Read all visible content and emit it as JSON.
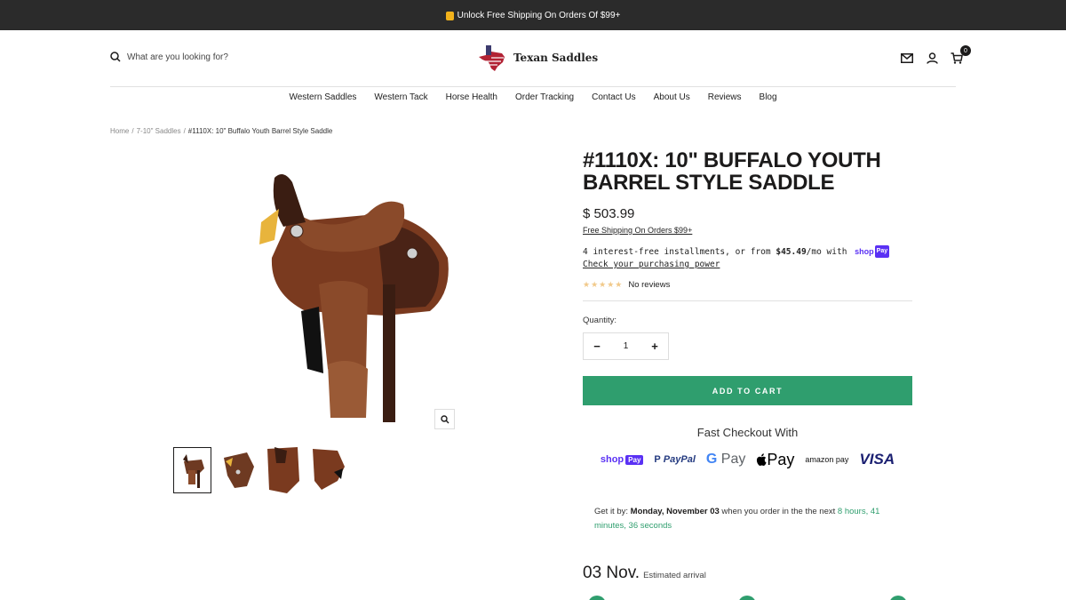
{
  "announcement": {
    "text": "Unlock Free Shipping On Orders Of $99+"
  },
  "header": {
    "search_placeholder": "What are you looking for?",
    "logo_text": "Texan Saddles",
    "cart_count": "0"
  },
  "nav": {
    "items": [
      "Western Saddles",
      "Western Tack",
      "Horse Health",
      "Order Tracking",
      "Contact Us",
      "About Us",
      "Reviews",
      "Blog"
    ]
  },
  "breadcrumb": {
    "home": "Home",
    "category": "7-10\" Saddles",
    "current": "#1110X: 10\" Buffalo Youth Barrel Style Saddle",
    "separator": "/"
  },
  "product": {
    "title": "#1110X: 10\" Buffalo Youth Barrel Style Saddle",
    "price": "$ 503.99",
    "shipping_link": "Free Shipping On Orders $99+",
    "installments_prefix": "4 interest-free installments, or from ",
    "installments_amount": "$45.49",
    "installments_suffix": "/mo with",
    "shop_label": "shop",
    "pay_label": "Pay",
    "check_power": "Check your purchasing power",
    "stars": "★★★★★",
    "rating_text": "No reviews",
    "quantity_label": "Quantity:",
    "quantity_value": "1",
    "minus": "−",
    "plus": "+",
    "add_to_cart": "ADD TO CART"
  },
  "checkout": {
    "heading": "Fast Checkout With",
    "shop": "shop",
    "shop_pay": "Pay",
    "paypal": "PayPal",
    "gpay_g": "G",
    "gpay": "Pay",
    "apple": "Pay",
    "amazon": "amazon pay",
    "visa": "VISA"
  },
  "delivery": {
    "prefix": "Get it by: ",
    "date": "Monday, November 03",
    "middle": " when you order in the the next ",
    "countdown": "8 hours, 41 minutes, 36 seconds",
    "arrival_date": "03 Nov.",
    "arrival_label": "Estimated arrival"
  },
  "colors": {
    "accent": "#2f9e6e",
    "announcement_bg": "#2b2b2b",
    "shop_pay": "#5a31f4"
  },
  "icons": [
    "lock-icon",
    "search-icon",
    "mail-icon",
    "account-icon",
    "cart-icon",
    "zoom-icon"
  ]
}
